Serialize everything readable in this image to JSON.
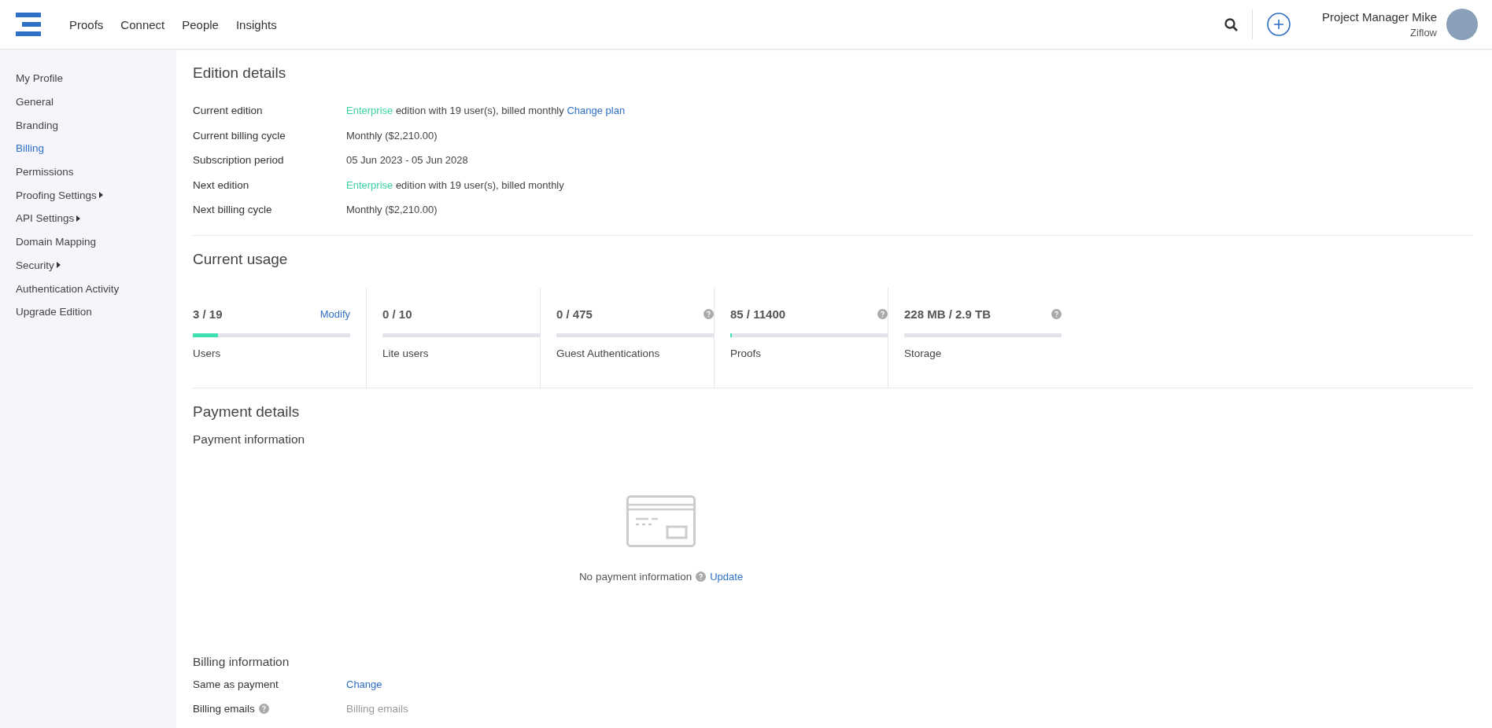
{
  "header": {
    "nav": [
      {
        "label": "Proofs"
      },
      {
        "label": "Connect"
      },
      {
        "label": "People"
      },
      {
        "label": "Insights"
      }
    ],
    "user": {
      "name": "Project Manager Mike",
      "org": "Ziflow"
    }
  },
  "sidebar": {
    "items": [
      {
        "label": "My Profile",
        "selected": false,
        "submenu": false
      },
      {
        "label": "General",
        "selected": false,
        "submenu": false
      },
      {
        "label": "Branding",
        "selected": false,
        "submenu": false
      },
      {
        "label": "Billing",
        "selected": true,
        "submenu": false
      },
      {
        "label": "Permissions",
        "selected": false,
        "submenu": false
      },
      {
        "label": "Proofing Settings",
        "selected": false,
        "submenu": true
      },
      {
        "label": "API Settings",
        "selected": false,
        "submenu": true
      },
      {
        "label": "Domain Mapping",
        "selected": false,
        "submenu": false
      },
      {
        "label": "Security",
        "selected": false,
        "submenu": true
      },
      {
        "label": "Authentication Activity",
        "selected": false,
        "submenu": false
      },
      {
        "label": "Upgrade Edition",
        "selected": false,
        "submenu": false
      }
    ]
  },
  "edition_details": {
    "title": "Edition details",
    "rows": [
      {
        "label": "Current edition",
        "edition": "Enterprise",
        "value": "edition with 19 user(s), billed monthly",
        "link": "Change plan"
      },
      {
        "label": "Current billing cycle",
        "value": "Monthly ($2,210.00)"
      },
      {
        "label": "Subscription period",
        "value": "05 Jun 2023 - 05 Jun 2028"
      },
      {
        "label": "Next edition",
        "edition": "Enterprise",
        "value": "edition with 19 user(s), billed monthly"
      },
      {
        "label": "Next billing cycle",
        "value": "Monthly ($2,210.00)"
      }
    ]
  },
  "current_usage": {
    "title": "Current usage",
    "items": [
      {
        "value": "3 / 19",
        "label": "Users",
        "level": 0.16,
        "link": "Modify",
        "help": false
      },
      {
        "value": "0 / 10",
        "label": "Lite users",
        "level": 0,
        "help": false
      },
      {
        "value": "0 / 475",
        "label": "Guest Authentications",
        "level": 0,
        "help": true
      },
      {
        "value": "85 / 11400",
        "label": "Proofs",
        "level": 0.007,
        "help": true
      },
      {
        "value": "228 MB / 2.9 TB",
        "label": "Storage",
        "level": 0,
        "help": true
      }
    ]
  },
  "payment_details": {
    "title": "Payment details",
    "payment_information": {
      "title": "Payment information",
      "empty_text": "No payment information",
      "link": "Update"
    },
    "billing_information": {
      "title": "Billing information",
      "rows": [
        {
          "kind": "link",
          "label": "Same as payment",
          "help": false,
          "value": "Change"
        },
        {
          "kind": "field",
          "label": "Billing emails",
          "help": true,
          "placeholder": "Billing emails"
        }
      ]
    }
  }
}
